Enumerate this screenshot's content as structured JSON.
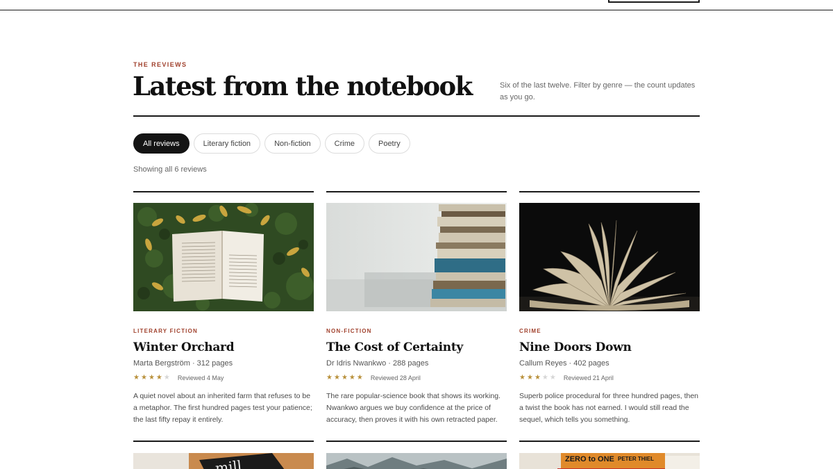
{
  "header": {
    "eyebrow": "THE REVIEWS",
    "title": "Latest from the notebook",
    "subtitle": "Six of the last twelve. Filter by genre — the count updates as you go."
  },
  "filters": [
    {
      "label": "All reviews",
      "active": true
    },
    {
      "label": "Literary fiction",
      "active": false
    },
    {
      "label": "Non-fiction",
      "active": false
    },
    {
      "label": "Crime",
      "active": false
    },
    {
      "label": "Poetry",
      "active": false
    }
  ],
  "count_text": "Showing all 6 reviews",
  "reviews": [
    {
      "genre": "LITERARY FICTION",
      "title": "Winter Orchard",
      "meta": "Marta Bergström · 312 pages",
      "stars": 4,
      "reviewed": "Reviewed 4 May",
      "blurb": "A quiet novel about an inherited farm that refuses to be a metaphor. The first hundred pages test your patience; the last fifty repay it entirely."
    },
    {
      "genre": "NON-FICTION",
      "title": "The Cost of Certainty",
      "meta": "Dr Idris Nwankwo · 288 pages",
      "stars": 5,
      "reviewed": "Reviewed 28 April",
      "blurb": "The rare popular-science book that shows its working. Nwankwo argues we buy confidence at the price of accuracy, then proves it with his own retracted paper."
    },
    {
      "genre": "CRIME",
      "title": "Nine Doors Down",
      "meta": "Callum Reyes · 402 pages",
      "stars": 3,
      "reviewed": "Reviewed 21 April",
      "blurb": "Superb police procedural for three hundred pages, then a twist the book has not earned. I would still read the sequel, which tells you something."
    }
  ],
  "partial_cover_texts": {
    "card4": "mill",
    "card6_a": "ZERO to ONE",
    "card6_b": "PETER THIEL"
  },
  "colors": {
    "accent": "#a0412d",
    "star": "#b9913c",
    "ink": "#141414"
  }
}
